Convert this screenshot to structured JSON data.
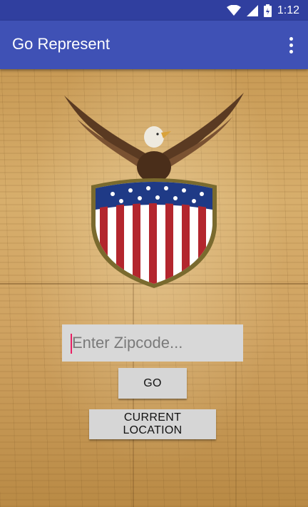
{
  "status_bar": {
    "time": "1:12",
    "icons": [
      "wifi-icon",
      "cell-signal-icon",
      "battery-icon"
    ]
  },
  "app_bar": {
    "title": "Go Represent",
    "menu_icon": "overflow-menu-icon"
  },
  "main": {
    "emblem": "eagle-shield-emblem",
    "zip_input": {
      "placeholder": "Enter Zipcode...",
      "value": ""
    },
    "go_button": "GO",
    "current_location_button": "CURRENT LOCATION"
  },
  "colors": {
    "status_bar": "#303f9f",
    "app_bar": "#3f51b5",
    "accent_caret": "#e91e63",
    "button_bg": "#d6d6d6"
  }
}
